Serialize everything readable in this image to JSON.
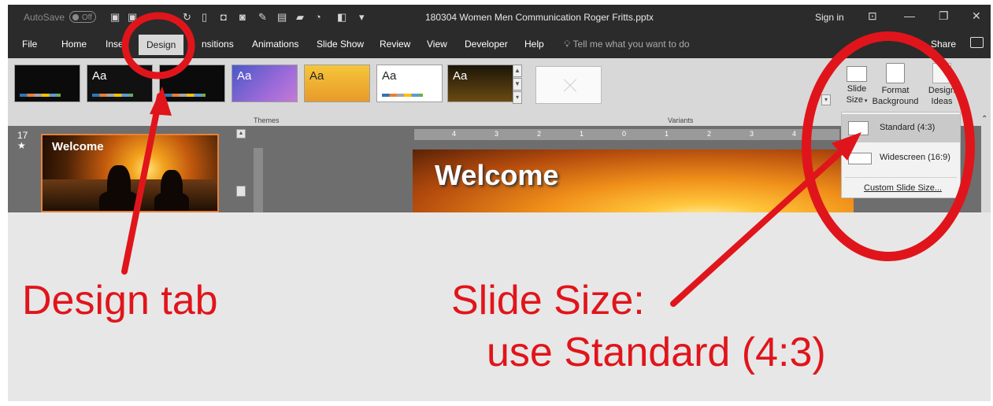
{
  "titlebar": {
    "autosave_label": "AutoSave",
    "autosave_state": "Off",
    "file_name": "180304 Women Men Communication Roger Fritts.pptx",
    "sign_in": "Sign in"
  },
  "tabs": [
    {
      "label": "File"
    },
    {
      "label": "Home"
    },
    {
      "label": "Inse"
    },
    {
      "label": "Design"
    },
    {
      "label": "nsitions"
    },
    {
      "label": "Animations"
    },
    {
      "label": "Slide Show"
    },
    {
      "label": "Review"
    },
    {
      "label": "View"
    },
    {
      "label": "Developer"
    },
    {
      "label": "Help"
    }
  ],
  "tell_me": "Tell me what you want to do",
  "share": "Share",
  "ribbon": {
    "themes_label": "Themes",
    "variants_label": "Variants",
    "theme_tile_text": "Aa",
    "slide_size": {
      "line1": "Slide",
      "line2": "Size"
    },
    "format_background": {
      "line1": "Format",
      "line2": "Background"
    },
    "design_ideas": {
      "line1": "Design",
      "line2": "Ideas"
    }
  },
  "slides_pane": {
    "slide_number": "17",
    "star": "★",
    "thumb_title": "Welcome"
  },
  "editor": {
    "slide_title": "Welcome",
    "ruler_ticks": [
      "4",
      "3",
      "2",
      "1",
      "0",
      "1",
      "2",
      "3",
      "4"
    ]
  },
  "slide_size_menu": {
    "standard": "Standard (4:3)",
    "widescreen": "Widescreen (16:9)",
    "custom": "Custom Slide Size..."
  },
  "annotations": {
    "design_tab": "Design tab",
    "slide_size_line1": "Slide Size:",
    "slide_size_line2": "use Standard (4:3)"
  },
  "colors": {
    "annotation_red": "#e0151b",
    "titlebar_bg": "#2b2b2b",
    "ribbon_bg": "#d8d8d8"
  }
}
